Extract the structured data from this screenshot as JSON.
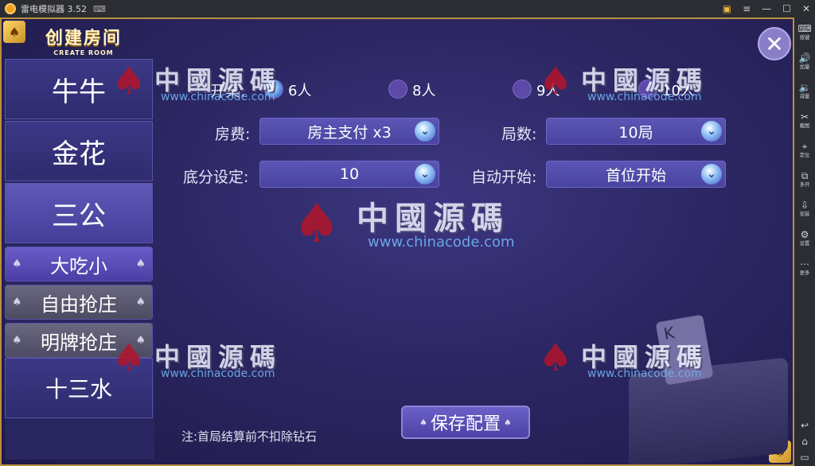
{
  "window": {
    "title": "雷电模拟器 3.52",
    "controls": [
      "▭",
      "≡",
      "—",
      "☐",
      "✕"
    ]
  },
  "toolbar": [
    {
      "icon": "keyboard-icon",
      "label": "按键"
    },
    {
      "icon": "volume-up-icon",
      "label": "加量"
    },
    {
      "icon": "volume-down-icon",
      "label": "减量"
    },
    {
      "icon": "scissors-icon",
      "label": "截图"
    },
    {
      "icon": "location-icon",
      "label": "定位"
    },
    {
      "icon": "multi-window-icon",
      "label": "多开"
    },
    {
      "icon": "install-icon",
      "label": "安装"
    },
    {
      "icon": "gear-icon",
      "label": "设置"
    },
    {
      "icon": "more-icon",
      "label": "更多"
    }
  ],
  "sidebar": {
    "title": "创建房间",
    "subtitle": "CREATE ROOM",
    "tabs": [
      "牛牛",
      "金花",
      "三公",
      "大吃小",
      "自由抢庄",
      "明牌抢庄",
      "十三水"
    ]
  },
  "form": {
    "table_label": "开桌:",
    "player_options": [
      "6人",
      "8人",
      "9人",
      "10人"
    ],
    "selected_players": "6人",
    "fee_label": "房费:",
    "fee_value": "房主支付 x3",
    "rounds_label": "局数:",
    "rounds_value": "10局",
    "base_label": "底分设定:",
    "base_value": "10",
    "autostart_label": "自动开始:",
    "autostart_value": "首位开始"
  },
  "note": "注:首局结算前不扣除钻石",
  "save_label": "保存配置",
  "watermark": {
    "text": "中國源碼",
    "url": "www.chinacode.com"
  },
  "deco": {
    "card_letter": "K"
  },
  "colors": {
    "frame": "#b8913e",
    "background": "#2c2763",
    "accent": "#5b55b5",
    "watermark_logo": "#b3142a"
  }
}
